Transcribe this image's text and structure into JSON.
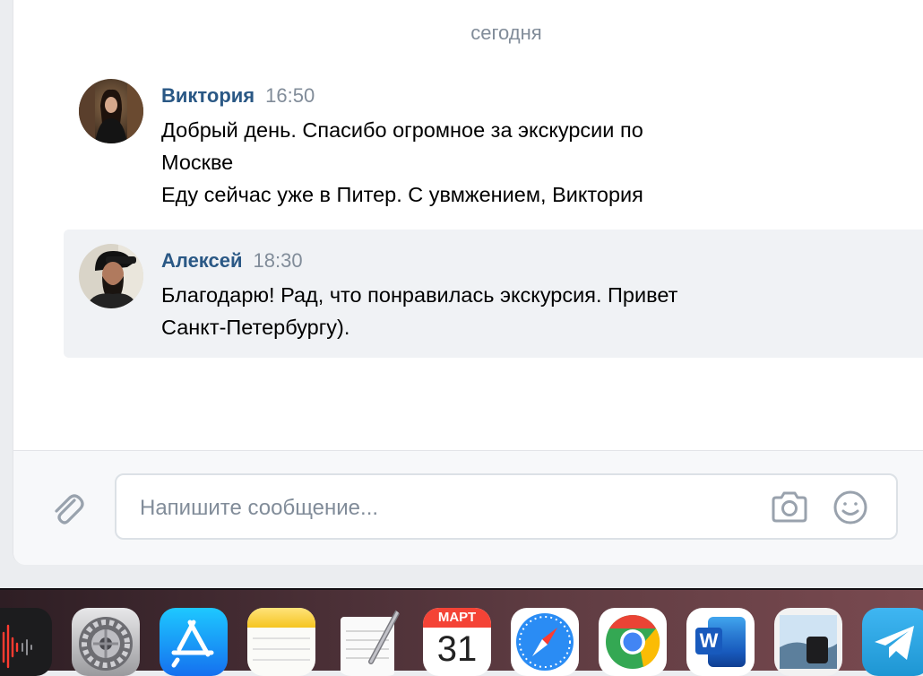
{
  "chat": {
    "date_separator": "сегодня",
    "messages": [
      {
        "author": "Виктория",
        "time": "16:50",
        "lines": [
          "Добрый день. Спасибо огромное за экскурсии по",
          "Москве",
          "Еду сейчас уже в Питер. С увмжением, Виктория"
        ]
      },
      {
        "author": "Алексей",
        "time": "18:30",
        "lines": [
          "Благодарю! Рад, что понравилась экскурсия. Привет",
          "Санкт-Петербургу)."
        ]
      }
    ]
  },
  "composer": {
    "placeholder": "Напишите сообщение...",
    "value": ""
  },
  "dock": {
    "calendar": {
      "month": "МАРТ",
      "day": "31"
    },
    "apps": [
      "voice-memos-icon",
      "system-preferences-icon",
      "app-store-icon",
      "notes-icon",
      "textedit-icon",
      "calendar-icon",
      "safari-icon",
      "chrome-icon",
      "word-icon",
      "preview-icon",
      "telegram-icon"
    ],
    "word_letter": "W"
  },
  "colors": {
    "author": "#2a5885",
    "secondary_text": "#818c99",
    "highlight_bg": "#f0f2f5"
  }
}
